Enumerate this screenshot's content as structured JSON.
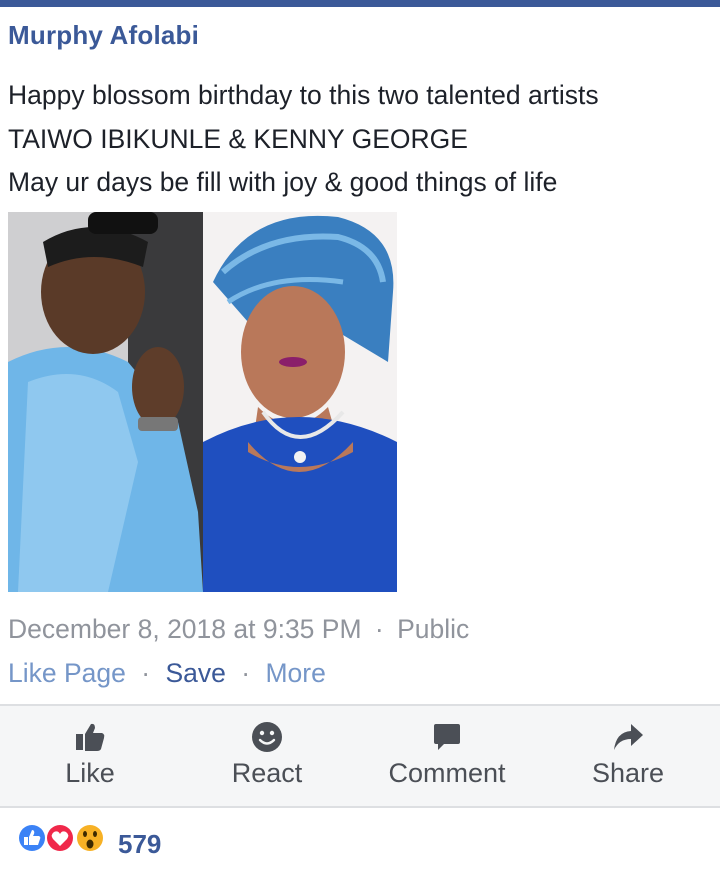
{
  "post": {
    "author": "Murphy Afolabi",
    "text_lines": [
      "Happy blossom birthday to this two talented artists",
      "TAIWO  IBIKUNLE & KENNY GEORGE",
      "May ur days be fill with joy & good things of life"
    ],
    "timestamp": "December 8, 2018 at 9:35 PM",
    "separator": "·",
    "privacy": "Public"
  },
  "links": {
    "like_page": "Like Page",
    "save": "Save",
    "more": "More"
  },
  "actions": {
    "like": "Like",
    "react": "React",
    "comment": "Comment",
    "share": "Share"
  },
  "reactions": {
    "count": "579",
    "icons": [
      "like-reaction-icon",
      "love-reaction-icon",
      "wow-reaction-icon"
    ]
  },
  "colors": {
    "brand": "#3b5998",
    "link_light": "#7596c8",
    "meta_gray": "#90949c",
    "love": "#f0284a",
    "wow": "#f7b125"
  }
}
